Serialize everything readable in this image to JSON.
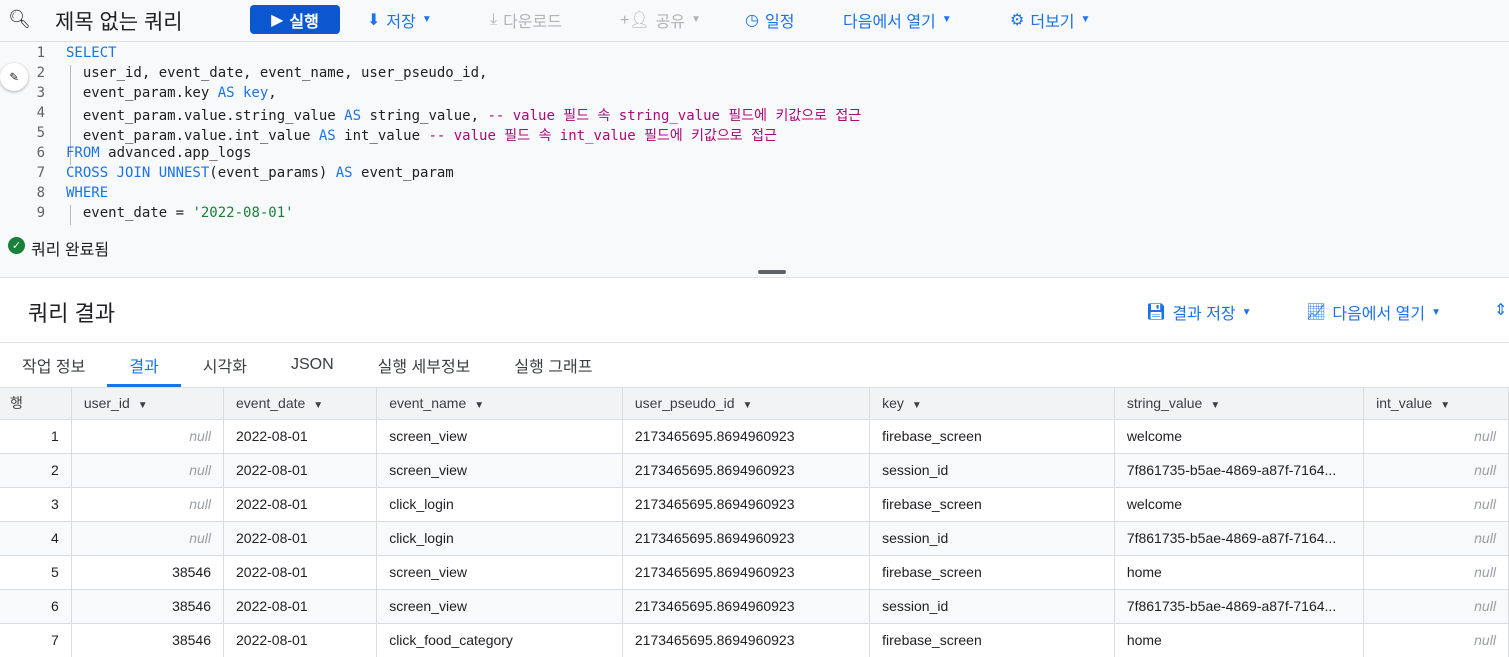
{
  "header": {
    "title": "제목 없는 쿼리",
    "run": "실행",
    "save": "저장",
    "download": "다운로드",
    "share": "공유",
    "schedule": "일정",
    "open_in": "다음에서 열기",
    "more": "더보기"
  },
  "editor": {
    "lines": [
      [
        [
          "kw",
          "SELECT"
        ]
      ],
      [
        [
          "",
          "  user_id, event_date, event_name, user_pseudo_id,"
        ]
      ],
      [
        [
          "",
          "  event_param.key "
        ],
        [
          "kw",
          "AS key"
        ],
        [
          "",
          ","
        ]
      ],
      [
        [
          "",
          "  event_param.value.string_value "
        ],
        [
          "kw",
          "AS"
        ],
        [
          "",
          " string_value, "
        ],
        [
          "cm",
          "-- value 필드 속 string_value 필드에 키값으로 접근"
        ]
      ],
      [
        [
          "",
          "  event_param.value.int_value "
        ],
        [
          "kw",
          "AS"
        ],
        [
          "",
          " int_value "
        ],
        [
          "cm",
          "-- value 필드 속 int_value 필드에 키값으로 접근"
        ]
      ],
      [
        [
          "kw",
          "FROM"
        ],
        [
          "",
          " advanced.app_logs"
        ]
      ],
      [
        [
          "kw",
          "CROSS JOIN UNNEST"
        ],
        [
          "",
          "(event_params) "
        ],
        [
          "kw",
          "AS"
        ],
        [
          "",
          " event_param"
        ]
      ],
      [
        [
          "kw",
          "WHERE"
        ]
      ],
      [
        [
          "",
          "  event_date = "
        ],
        [
          "str",
          "'2022-08-01'"
        ]
      ]
    ]
  },
  "status": "쿼리 완료됨",
  "results": {
    "title": "쿼리 결과",
    "save_results": "결과 저장",
    "open_in": "다음에서 열기",
    "tabs": [
      "작업 정보",
      "결과",
      "시각화",
      "JSON",
      "실행 세부정보",
      "실행 그래프"
    ],
    "active_tab": 1,
    "columns": [
      "행",
      "user_id",
      "event_date",
      "event_name",
      "user_pseudo_id",
      "key",
      "string_value",
      "int_value"
    ],
    "rows": [
      [
        "1",
        "null",
        "2022-08-01",
        "screen_view",
        "2173465695.8694960923",
        "firebase_screen",
        "welcome",
        "null"
      ],
      [
        "2",
        "null",
        "2022-08-01",
        "screen_view",
        "2173465695.8694960923",
        "session_id",
        "7f861735-b5ae-4869-a87f-7164...",
        "null"
      ],
      [
        "3",
        "null",
        "2022-08-01",
        "click_login",
        "2173465695.8694960923",
        "firebase_screen",
        "welcome",
        "null"
      ],
      [
        "4",
        "null",
        "2022-08-01",
        "click_login",
        "2173465695.8694960923",
        "session_id",
        "7f861735-b5ae-4869-a87f-7164...",
        "null"
      ],
      [
        "5",
        "38546",
        "2022-08-01",
        "screen_view",
        "2173465695.8694960923",
        "firebase_screen",
        "home",
        "null"
      ],
      [
        "6",
        "38546",
        "2022-08-01",
        "screen_view",
        "2173465695.8694960923",
        "session_id",
        "7f861735-b5ae-4869-a87f-7164...",
        "null"
      ],
      [
        "7",
        "38546",
        "2022-08-01",
        "click_food_category",
        "2173465695.8694960923",
        "firebase_screen",
        "home",
        "null"
      ]
    ]
  }
}
